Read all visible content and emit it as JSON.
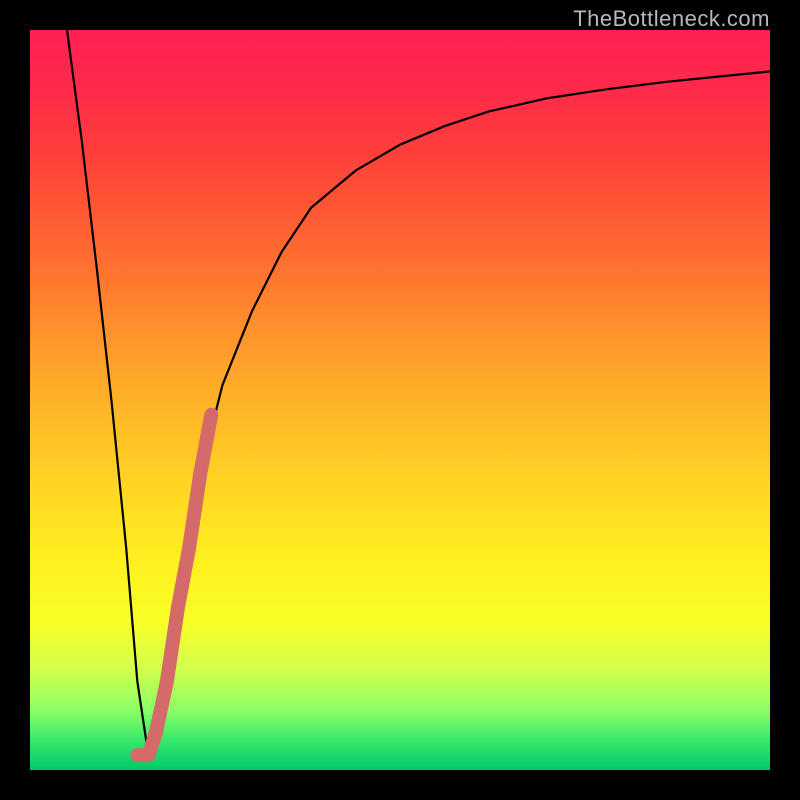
{
  "watermark": "TheBottleneck.com",
  "chart_data": {
    "type": "line",
    "title": "",
    "xlabel": "",
    "ylabel": "",
    "xlim": [
      0,
      100
    ],
    "ylim": [
      0,
      100
    ],
    "grid": false,
    "series": [
      {
        "name": "bottleneck-curve",
        "color": "#000000",
        "x": [
          5,
          7,
          9,
          11,
          13,
          14.5,
          16,
          18,
          20,
          23,
          26,
          30,
          34,
          38,
          44,
          50,
          56,
          62,
          70,
          78,
          86,
          94,
          100
        ],
        "y": [
          100,
          85,
          68,
          50,
          30,
          12,
          2,
          8,
          22,
          40,
          52,
          62,
          70,
          76,
          81,
          84.5,
          87,
          89,
          90.8,
          92,
          93,
          93.8,
          94.4
        ]
      },
      {
        "name": "highlight-segment",
        "color": "#d46a6a",
        "x": [
          14.5,
          16,
          17,
          18.5,
          20,
          21.5,
          23,
          24.5
        ],
        "y": [
          2,
          2,
          5,
          12,
          22,
          30,
          40,
          48
        ]
      }
    ]
  }
}
